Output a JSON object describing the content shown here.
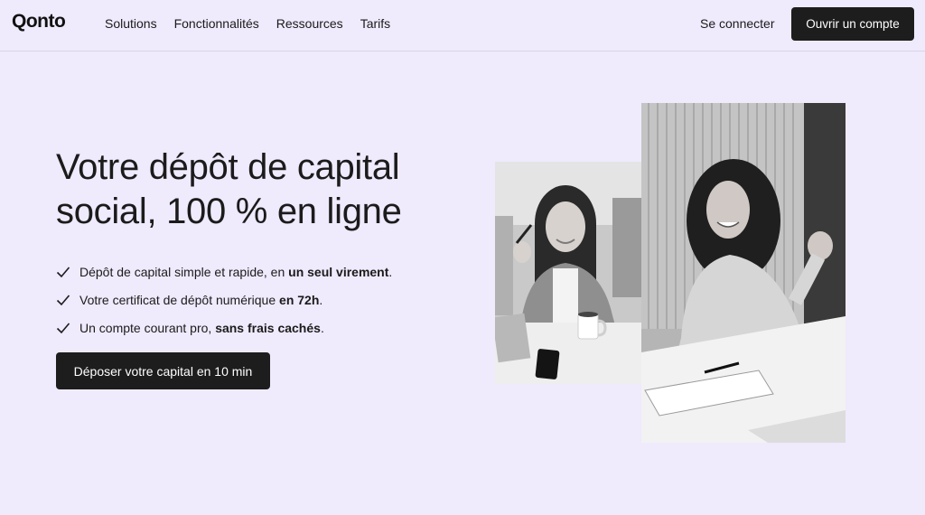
{
  "header": {
    "logo": "Qonto",
    "nav": [
      "Solutions",
      "Fonctionnalités",
      "Ressources",
      "Tarifs"
    ],
    "login": "Se connecter",
    "open_account": "Ouvrir un compte"
  },
  "hero": {
    "title": "Votre dépôt de capital social, 100 % en ligne",
    "features": [
      {
        "text": "Dépôt de capital simple et rapide, en ",
        "bold": "un seul virement",
        "end": "."
      },
      {
        "text": "Votre certificat de dépôt numérique ",
        "bold": "en 72h",
        "end": "."
      },
      {
        "text": "Un compte courant pro, ",
        "bold": "sans frais cachés",
        "end": "."
      }
    ],
    "cta": "Déposer votre capital en 10 min"
  },
  "colors": {
    "background": "#efeafc",
    "button": "#1d1d1d",
    "text": "#1b1b1b"
  },
  "icons": [
    "check-icon"
  ]
}
